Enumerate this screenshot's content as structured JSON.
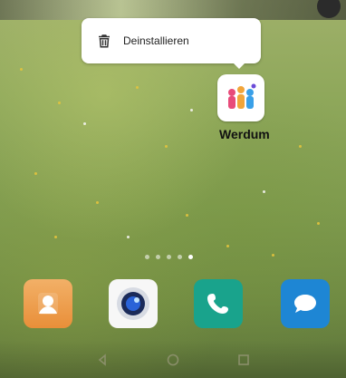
{
  "context_menu": {
    "uninstall_label": "Deinstallieren"
  },
  "home_app": {
    "label": "Werdum"
  },
  "page_indicator": {
    "count": 5,
    "active_index": 4
  },
  "dock": {
    "apps": [
      "contacts-icon",
      "camera-icon",
      "phone-icon",
      "messages-icon"
    ]
  },
  "nav": {
    "icons": [
      "back-icon",
      "home-icon",
      "recent-apps-icon"
    ]
  },
  "colors": {
    "selection": "#9bbef0",
    "phone_bg": "#19a38c",
    "messages_bg": "#1e86d4",
    "contacts_bg": "#e98f39"
  }
}
